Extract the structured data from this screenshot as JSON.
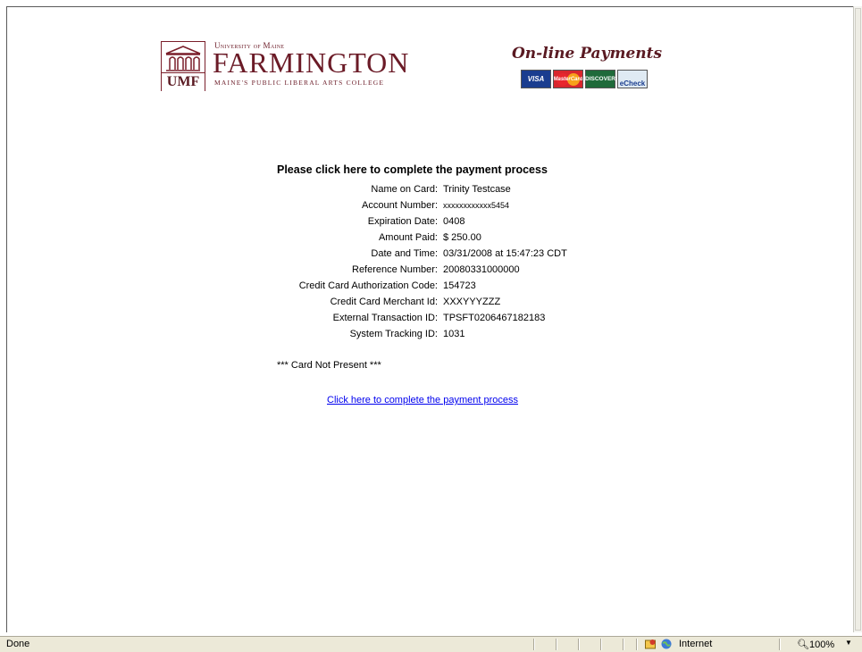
{
  "header": {
    "logo": {
      "top_line": "University of Maine",
      "name": "FARMINGTON",
      "tagline": "MAINE'S PUBLIC LIBERAL ARTS COLLEGE",
      "mark_text": "UMF"
    },
    "payments_title": "On-line Payments",
    "cards": [
      {
        "label": "VISA"
      },
      {
        "label": "MasterCard"
      },
      {
        "label": "DISCOVER"
      },
      {
        "label": "eCheck"
      }
    ]
  },
  "main": {
    "heading": "Please click here to complete the payment process",
    "details": [
      {
        "label": "Name on Card:",
        "value": "Trinity Testcase"
      },
      {
        "label": "Account Number:",
        "value": "xxxxxxxxxxxx5454"
      },
      {
        "label": "Expiration Date:",
        "value": "0408"
      },
      {
        "label": "Amount Paid:",
        "value": "$ 250.00"
      },
      {
        "label": "Date and Time:",
        "value": "03/31/2008 at 15:47:23 CDT"
      },
      {
        "label": "Reference Number:",
        "value": "20080331000000"
      },
      {
        "label": "Credit Card Authorization Code:",
        "value": "154723"
      },
      {
        "label": "Credit Card Merchant Id:",
        "value": "XXXYYYZZZ"
      },
      {
        "label": "External Transaction ID:",
        "value": "TPSFT0206467182183"
      },
      {
        "label": "System Tracking ID:",
        "value": "1031"
      }
    ],
    "card_not_present": "*** Card Not Present ***",
    "complete_link": "Click here to complete the payment process"
  },
  "statusbar": {
    "status": "Done",
    "zone": "Internet",
    "zoom": "100%"
  },
  "colors": {
    "brand": "#6b1b27",
    "link": "#0000ee",
    "statusbar_bg": "#ece9d8"
  }
}
